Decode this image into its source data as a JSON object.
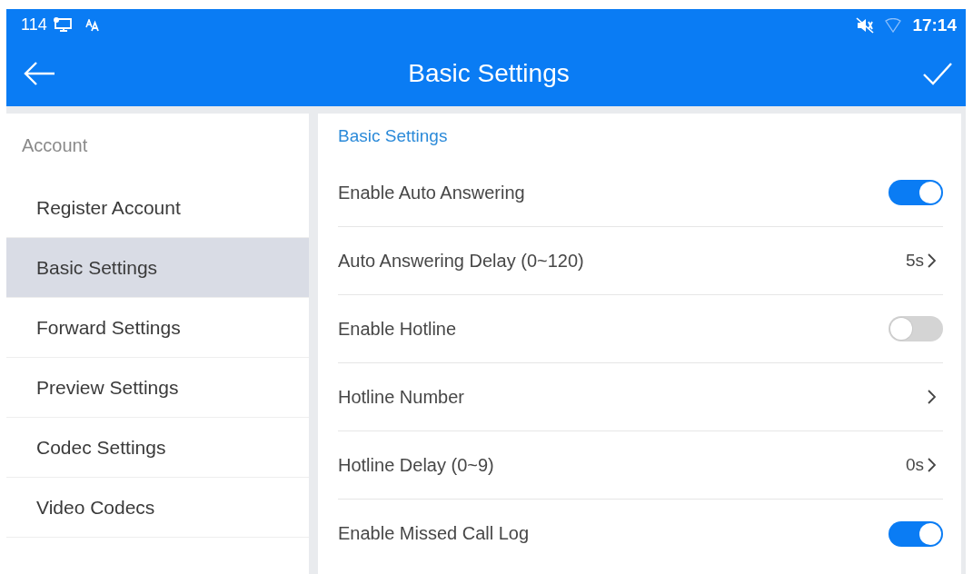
{
  "status_bar": {
    "left_text": "114",
    "time": "17:14"
  },
  "app_bar": {
    "title": "Basic Settings"
  },
  "sidebar": {
    "section": "Account",
    "items": [
      {
        "label": "Register Account",
        "selected": false
      },
      {
        "label": "Basic Settings",
        "selected": true
      },
      {
        "label": "Forward Settings",
        "selected": false
      },
      {
        "label": "Preview Settings",
        "selected": false
      },
      {
        "label": "Codec Settings",
        "selected": false
      },
      {
        "label": "Video Codecs",
        "selected": false
      }
    ]
  },
  "panel": {
    "heading": "Basic Settings",
    "rows": [
      {
        "kind": "toggle",
        "label": "Enable Auto Answering",
        "on": true
      },
      {
        "kind": "nav",
        "label": "Auto Answering Delay (0~120)",
        "value": "5s"
      },
      {
        "kind": "toggle",
        "label": "Enable Hotline",
        "on": false
      },
      {
        "kind": "nav",
        "label": "Hotline Number"
      },
      {
        "kind": "nav",
        "label": "Hotline Delay (0~9)",
        "value": "0s"
      },
      {
        "kind": "toggle",
        "label": "Enable Missed Call Log",
        "on": true
      }
    ]
  }
}
